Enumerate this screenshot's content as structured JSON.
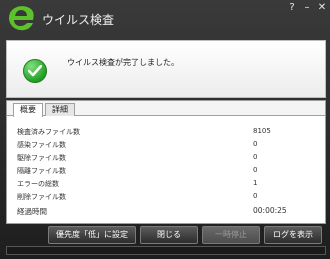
{
  "window": {
    "title": "ウイルス検査",
    "help_label": "?",
    "minimize_label": "–",
    "close_label": "✕"
  },
  "banner": {
    "message": "ウイルス検査が完了しました。"
  },
  "tabs": [
    {
      "label": "概要",
      "active": true
    },
    {
      "label": "詳細",
      "active": false
    }
  ],
  "summary": [
    {
      "label": "検査済みファイル数",
      "value": "8105"
    },
    {
      "label": "感染ファイル数",
      "value": "0"
    },
    {
      "label": "駆除ファイル数",
      "value": "0"
    },
    {
      "label": "隔離ファイル数",
      "value": "0"
    },
    {
      "label": "エラーの総数",
      "value": "1"
    },
    {
      "label": "削除ファイル数",
      "value": "0"
    },
    {
      "label": "経過時間",
      "value": "00:00:25"
    }
  ],
  "buttons": {
    "priority": "優先度「低」に設定",
    "close": "閉じる",
    "pause": "一時停止",
    "show_log": "ログを表示"
  },
  "icons": {
    "logo": "trend-micro-logo",
    "status": "check-icon"
  },
  "colors": {
    "logo_green": "#5cc12a",
    "check_green": "#1d9d1d"
  }
}
